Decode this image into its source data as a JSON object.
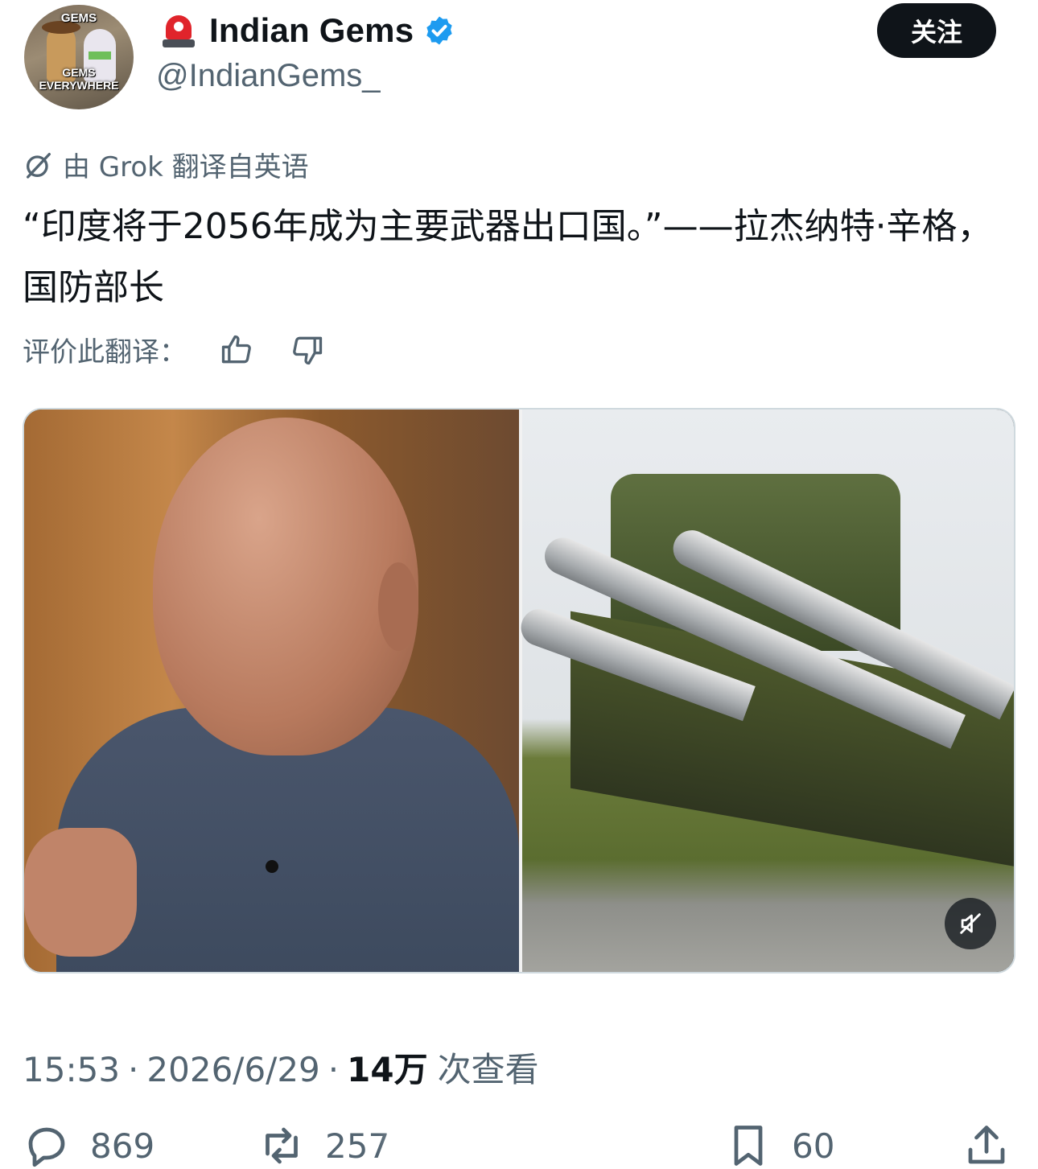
{
  "user": {
    "display_name": "Indian Gems",
    "handle": "@IndianGems_",
    "avatar_caption_top": "GEMS",
    "avatar_caption_bottom": "GEMS EVERYWHERE",
    "verified": true,
    "emoji_icon": "siren-icon"
  },
  "follow_label": "关注",
  "translation": {
    "notice": "由 Grok 翻译自英语",
    "rate_label": "评价此翻译："
  },
  "tweet_text": "“印度将于2056年成为主要武器出口国。”——拉杰纳特·辛格，国防部长",
  "meta": {
    "time": "15:53",
    "date": "2026/6/29",
    "views": "14万",
    "views_label": "次查看"
  },
  "actions": {
    "replies": "869",
    "reposts": "257",
    "bookmarks": "60"
  },
  "colors": {
    "text": "#0f1419",
    "secondary": "#536471",
    "verified": "#1d9bf0",
    "follow_bg": "#0f1419"
  }
}
